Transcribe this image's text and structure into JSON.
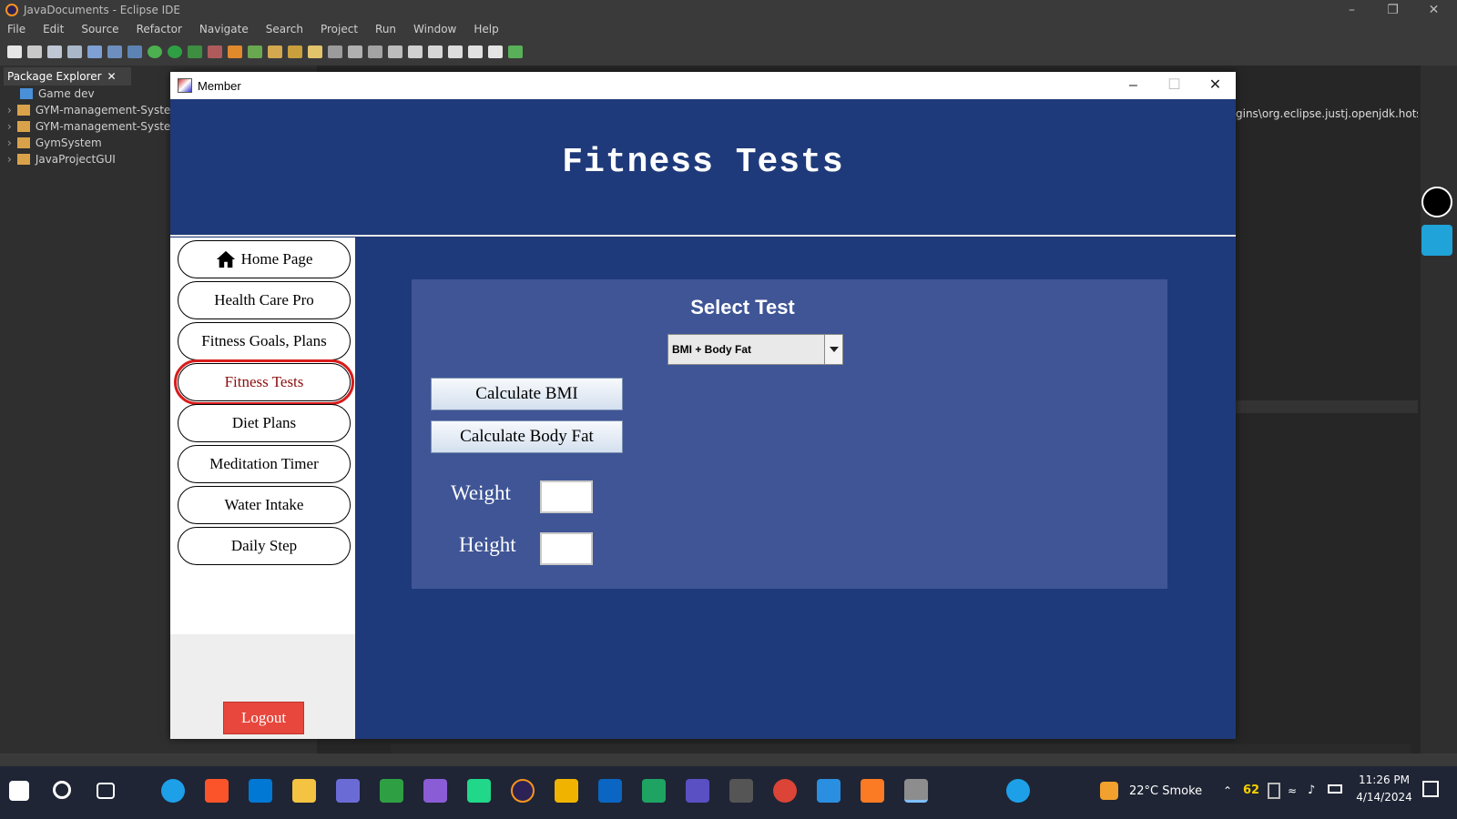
{
  "eclipse": {
    "window_title": "JavaDocuments - Eclipse IDE",
    "menu": [
      "File",
      "Edit",
      "Source",
      "Refactor",
      "Navigate",
      "Search",
      "Project",
      "Run",
      "Window",
      "Help"
    ],
    "package_explorer": {
      "tab_label": "Package Explorer",
      "items": [
        "Game dev",
        "GYM-management-System",
        "GYM-management-System",
        "GymSystem",
        "JavaProjectGUI"
      ]
    },
    "editor_path_fragment": "gins\\org.eclipse.justj.openjdk.hotspot.jre.f"
  },
  "member_window": {
    "title": "Member",
    "page_title": "Fitness Tests",
    "nav": [
      {
        "label": "Home Page",
        "active": false
      },
      {
        "label": "Health Care Pro",
        "active": false
      },
      {
        "label": "Fitness Goals, Plans",
        "active": false
      },
      {
        "label": "Fitness Tests",
        "active": true
      },
      {
        "label": "Diet Plans",
        "active": false
      },
      {
        "label": "Meditation Timer",
        "active": false
      },
      {
        "label": "Water Intake",
        "active": false
      },
      {
        "label": "Daily Step",
        "active": false
      }
    ],
    "logout_label": "Logout",
    "panel": {
      "heading": "Select Test",
      "select_value": "BMI + Body Fat",
      "calc_bmi_label": "Calculate BMI",
      "calc_body_fat_label": "Calculate Body Fat",
      "weight_label": "Weight",
      "weight_value": "",
      "height_label": "Height",
      "height_value": ""
    },
    "colors": {
      "background": "#1f3a7a",
      "panel": "#3f5596",
      "active_nav_border": "#d81c1c",
      "logout": "#e7473c"
    }
  },
  "taskbar": {
    "weather": "22°C  Smoke",
    "time": "11:26 PM",
    "date": "4/14/2024",
    "battery_count": "62"
  }
}
